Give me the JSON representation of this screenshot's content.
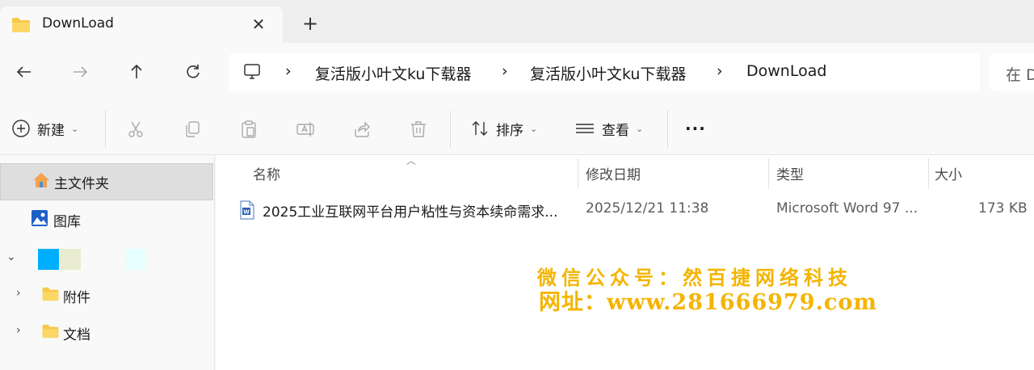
{
  "tab": {
    "title": "DownLoad",
    "close": "✕",
    "add": "+"
  },
  "address": {
    "breadcrumbs": [
      "复活版小叶文ku下载器",
      "复活版小叶文ku下载器",
      "DownLoad"
    ],
    "separator": "›",
    "search_placeholder": "在 D"
  },
  "toolbar": {
    "new_label": "新建",
    "sort_label": "排序",
    "view_label": "查看",
    "more_label": "···"
  },
  "sidebar": {
    "home": "主文件夹",
    "gallery": "图库",
    "folder1": "附件",
    "folder2": "文档"
  },
  "columns": {
    "name": "名称",
    "date": "修改日期",
    "type": "类型",
    "size": "大小"
  },
  "files": [
    {
      "name": "2025工业互联网平台用户粘性与资本续命需求...",
      "date": "2025/12/21 11:38",
      "type": "Microsoft Word 97 ...",
      "size": "173 KB"
    }
  ],
  "watermark": {
    "line1": "微信公众号：然百捷网络科技",
    "line2": "网址：www.281666979.com"
  },
  "colors": {
    "accent": "#0067c0",
    "folder": "#f8c948",
    "watermark": "#f4b400",
    "selected": "#dedede"
  }
}
